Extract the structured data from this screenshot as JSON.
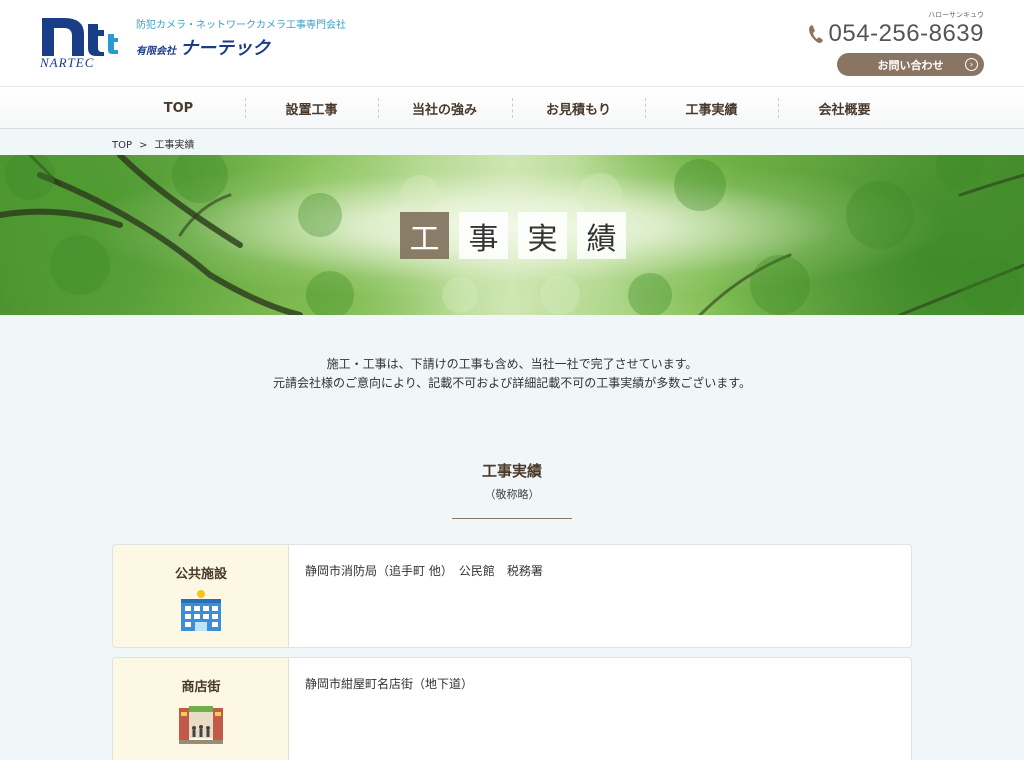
{
  "header": {
    "logo_text": "NARTEC",
    "tagline": "防犯カメラ・ネットワークカメラ工事専門会社",
    "company_prefix": "有限会社",
    "company_name": "ナーテック",
    "phone_kana": "ハローサンキュウ",
    "phone_number": "054-256-8639",
    "contact_label": "お問い合わせ"
  },
  "nav": {
    "items": [
      {
        "label": "TOP"
      },
      {
        "label": "設置工事"
      },
      {
        "label": "当社の強み"
      },
      {
        "label": "お見積もり"
      },
      {
        "label": "工事実績"
      },
      {
        "label": "会社概要"
      }
    ]
  },
  "breadcrumb": {
    "home": "TOP",
    "separator": ">",
    "current": "工事実績"
  },
  "hero": {
    "chars": [
      "工",
      "事",
      "実",
      "績"
    ]
  },
  "intro": {
    "line1": "施工・工事は、下請けの工事も含め、当社一社で完了させています。",
    "line2": "元請会社様のご意向により、記載不可および詳細記載不可の工事実績が多数ございます。"
  },
  "section": {
    "title": "工事実績",
    "subtitle": "（敬称略）"
  },
  "records": [
    {
      "category": "公共施設",
      "icon": "public-building-icon",
      "detail": "静岡市消防局（追手町 他）　公民館　税務署"
    },
    {
      "category": "商店街",
      "icon": "shopping-street-icon",
      "detail": "静岡市紺屋町名店街（地下道）"
    }
  ],
  "colors": {
    "brand_navy": "#1a3d88",
    "accent_brown": "#8a7563",
    "label_cream": "#fcf8e3",
    "page_bg": "#f1f6f9"
  }
}
